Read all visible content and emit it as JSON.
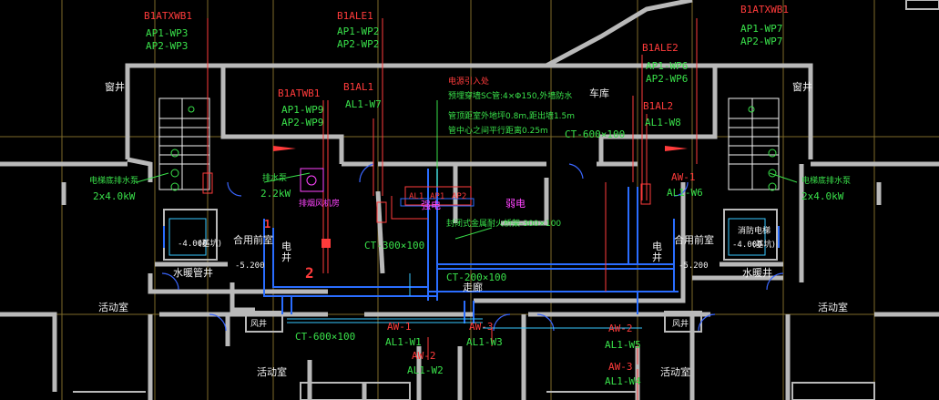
{
  "panels": {
    "b1atxwb1_left": {
      "name": "B1ATXWB1",
      "c1": "AP1-WP3",
      "c2": "AP2-WP3"
    },
    "b1ale1": {
      "name": "B1ALE1",
      "c1": "AP1-WP2",
      "c2": "AP2-WP2"
    },
    "b1atxwb1_right": {
      "name": "B1ATXWB1",
      "c1": "AP1-WP7",
      "c2": "AP2-WP7"
    },
    "b1ale2": {
      "name": "B1ALE2",
      "c1": "AP1-WP6",
      "c2": "AP2-WP6"
    },
    "b1atwb1": {
      "name": "B1ATWB1",
      "c1": "AP1-WP9",
      "c2": "AP2-WP9"
    },
    "b1al1": {
      "name": "B1AL1",
      "c1": "AL1-W7"
    },
    "b1al2": {
      "name": "B1AL2",
      "c1": "AL1-W8"
    },
    "aw1_right": {
      "name": "AW-1",
      "c1": "AL1-W6"
    },
    "aw1_bottom": {
      "name": "AW-1",
      "c1": "AL1-W1"
    },
    "aw2_bottom": {
      "name": "AW-2",
      "c1": "AL1-W2"
    },
    "aw3_bottom": {
      "name": "AW-3",
      "c1": "AL1-W3"
    },
    "aw2_right": {
      "name": "AW-2",
      "c1": "AL1-W5"
    },
    "aw3_right": {
      "name": "AW-3",
      "c1": "AL1-W4"
    }
  },
  "notes": {
    "line1": "电源引入处",
    "line2": "预埋穿墙SC管:4×Φ150,外墙防水",
    "line3": "管顶距室外地坪0.8m,距出墙1.5m",
    "line4": "管中心之间平行距离0.25m"
  },
  "trays": {
    "ct_600_100_top": "CT-600×100",
    "ct_300_100": "CT-300×100",
    "ct_200_100": "CT-200×100",
    "ct_600_100_bottom": "CT-600×100",
    "fireproof_tray": "封闭式金属耐火桥架-300×100"
  },
  "rooms": {
    "window_well_left": "窗井",
    "window_well_right": "窗井",
    "garage": "车库",
    "shared_front_room_left": "合用前室",
    "shared_front_room_right": "合用前室",
    "water_heat_well_left": "水暖管井",
    "water_heat_well_right": "水暖井",
    "activity_left": "活动室",
    "activity_right": "活动室",
    "activity_bottom_left": "活动室",
    "activity_bottom_right": "活动室",
    "corridor": "走廊",
    "electric_well_left": "电井",
    "electric_well_right": "电井",
    "weak_current": "弱电",
    "strong_current": "强电",
    "fire_smoke_room": "排烟风机房",
    "fan_room_left": "风井",
    "fan_room_right": "风井"
  },
  "equipment": {
    "elevator_pump_left": "电梯底排水泵",
    "elevator_pump_left_power": "2x4.0kW",
    "drain_pump": "排水泵",
    "drain_pump_power": "2.2kW",
    "elevator_pump_right": "电梯底排水泵",
    "elevator_pump_right_power": "2x4.0kW",
    "elev_left_level": "-4.000",
    "elev_left_note": "(基坑)",
    "elev_right_level": "-4.000",
    "elev_right_note": "(基坑)",
    "elev_right_title": "消防电梯",
    "level_left": "-5.200",
    "level_right": "-5.200",
    "small_al1": "AL1",
    "small_ap1": "AP1",
    "small_ap2": "AP2",
    "red_mark_1": "1",
    "red_mark_2": "2"
  },
  "colors": {
    "wall": "#b9b9b9",
    "green": "#39e04a",
    "red": "#ff3b3b",
    "cyan": "#39c8ff",
    "blue": "#2a6dff",
    "magenta": "#ff44ff",
    "white": "#f2f2f2",
    "background": "#000000"
  }
}
